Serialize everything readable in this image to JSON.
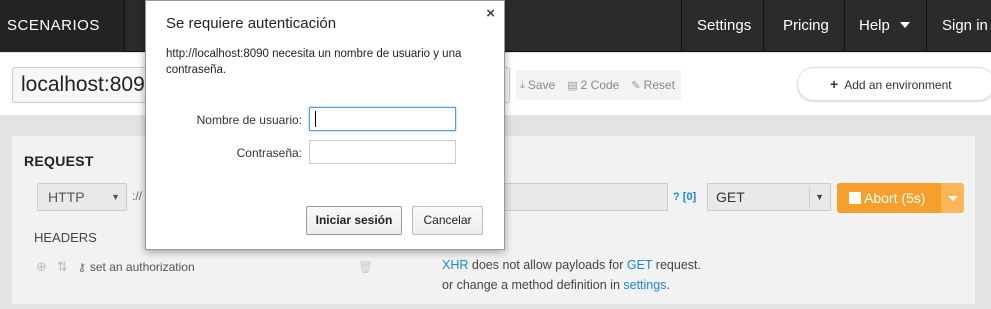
{
  "navbar": {
    "brand": "SCENARIOS",
    "items": [
      {
        "label": "Settings"
      },
      {
        "label": "Pricing"
      },
      {
        "label": "Help"
      },
      {
        "label": "Sign in"
      }
    ]
  },
  "toolbar": {
    "url_value": "localhost:8090",
    "save_label": "Save",
    "code_label": "2 Code",
    "reset_label": "Reset",
    "add_environment_label": "Add an environment"
  },
  "request": {
    "title": "REQUEST",
    "protocol": "HTTP",
    "scheme_sep": "://",
    "help_links": "? [0]",
    "method": "GET",
    "abort_label": "Abort (5s)",
    "headers_label": "HEADERS",
    "header_placeholder": "set an authorization",
    "note": {
      "xhr": "XHR",
      "text1": " does not allow payloads for ",
      "method": "GET",
      "text2": " request.",
      "line2_prefix": "or change a method definition in ",
      "settings_link": "settings",
      "line2_suffix": "."
    }
  },
  "auth_dialog": {
    "title": "Se requiere autenticación",
    "close": "×",
    "message": "http://localhost:8090 necesita un nombre de usuario y una contraseña.",
    "username_label": "Nombre de usuario:",
    "username_value": "",
    "password_label": "Contraseña:",
    "password_value": "",
    "login_button": "Iniciar sesión",
    "cancel_button": "Cancelar"
  },
  "colors": {
    "navbar_bg": "#2b2b2b",
    "accent_orange": "#f6a02b",
    "link_blue": "#1a8ad0"
  }
}
